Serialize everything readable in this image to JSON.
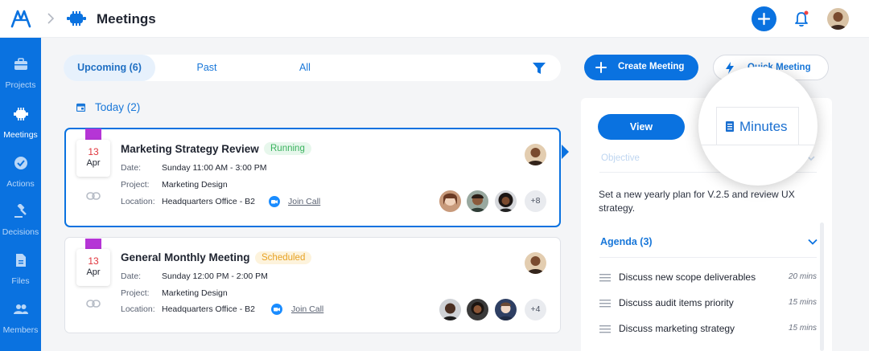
{
  "header": {
    "title": "Meetings"
  },
  "sidebar": {
    "items": [
      {
        "label": "Projects",
        "icon": "briefcase-icon"
      },
      {
        "label": "Meetings",
        "icon": "meetings-icon",
        "active": true
      },
      {
        "label": "Actions",
        "icon": "check-circle-icon"
      },
      {
        "label": "Decisions",
        "icon": "gavel-icon"
      },
      {
        "label": "Files",
        "icon": "file-icon"
      },
      {
        "label": "Members",
        "icon": "members-icon"
      }
    ]
  },
  "tabs": [
    {
      "label": "Upcoming (6)",
      "active": true
    },
    {
      "label": "Past"
    },
    {
      "label": "All"
    }
  ],
  "section": {
    "today": "Today (2)"
  },
  "meetings": [
    {
      "day": "13",
      "month": "Apr",
      "title": "Marketing Strategy Review",
      "status": "Running",
      "date_label": "Date:",
      "date_value": "Sunday 11:00 AM - 3:00 PM",
      "project_label": "Project:",
      "project_value": "Marketing Design",
      "location_label": "Location:",
      "location_value": "Headquarters Office - B2",
      "join_label": "Join Call",
      "extra_attendees": "+8"
    },
    {
      "day": "13",
      "month": "Apr",
      "title": "General Monthly Meeting",
      "status": "Scheduled",
      "date_label": "Date:",
      "date_value": "Sunday 12:00 PM - 2:00 PM",
      "project_label": "Project:",
      "project_value": "Marketing Design",
      "location_label": "Location:",
      "location_value": "Headquarters Office - B2",
      "join_label": "Join Call",
      "extra_attendees": "+4"
    }
  ],
  "actions": {
    "create": "Create Meeting",
    "quick": "Quick Meeting"
  },
  "detail": {
    "view_label": "View",
    "minutes_label": "Minutes",
    "objective_label": "Objective",
    "description": "Set a new yearly plan for V.2.5 and review UX strategy.",
    "agenda_title": "Agenda (3)",
    "agenda": [
      {
        "text": "Discuss new scope deliverables",
        "duration": "20 mins"
      },
      {
        "text": "Discuss audit items priority",
        "duration": "15 mins"
      },
      {
        "text": "Discuss marketing strategy",
        "duration": "15 mins"
      }
    ]
  },
  "colors": {
    "primary": "#0a72e0",
    "running": "#3bb35f",
    "scheduled": "#e7a225",
    "tag": "#b535d6",
    "date_red": "#e0343c"
  }
}
